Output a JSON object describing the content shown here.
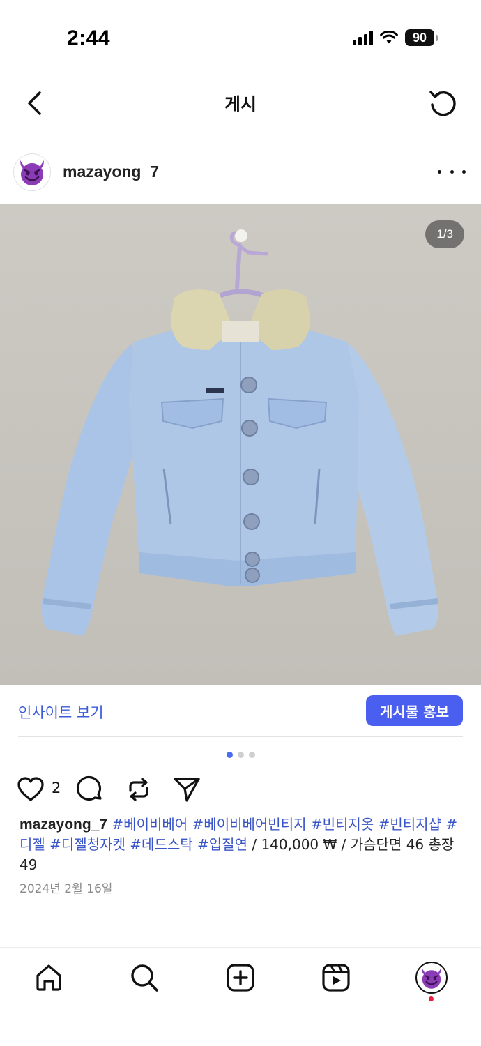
{
  "status_bar": {
    "time": "2:44",
    "battery": "90"
  },
  "header": {
    "title": "게시",
    "back_icon": "chevron-left-icon",
    "refresh_icon": "refresh-icon"
  },
  "post": {
    "username": "mazayong_7",
    "avatar_icon": "smiling-devil-emoji",
    "image_counter": "1/3",
    "image_subject": "light blue corduroy jacket with sherpa collar on hanger",
    "insights_label": "인사이트 보기",
    "promote_label": "게시물 홍보",
    "pagination": {
      "total": 3,
      "active": 1
    },
    "like_count": "2",
    "caption": {
      "username": "mazayong_7",
      "tags_line": [
        "#베이비베어",
        "#베이비베어빈티지",
        "#빈티지옷",
        "#빈티지샵",
        "#디젤",
        "#디젤청자켓",
        "#데드스탁",
        "#입질연"
      ],
      "text": "/ 140,000 ₩ / 가슴단면 46 총장 49"
    },
    "date": "2024년 2월 16일"
  },
  "bottom_nav": {
    "items": [
      "home-icon",
      "search-icon",
      "create-icon",
      "reels-icon",
      "profile-avatar"
    ]
  },
  "colors": {
    "accent": "#4a5ef0",
    "link": "#3a55c8",
    "notification": "#ee1d3b"
  }
}
